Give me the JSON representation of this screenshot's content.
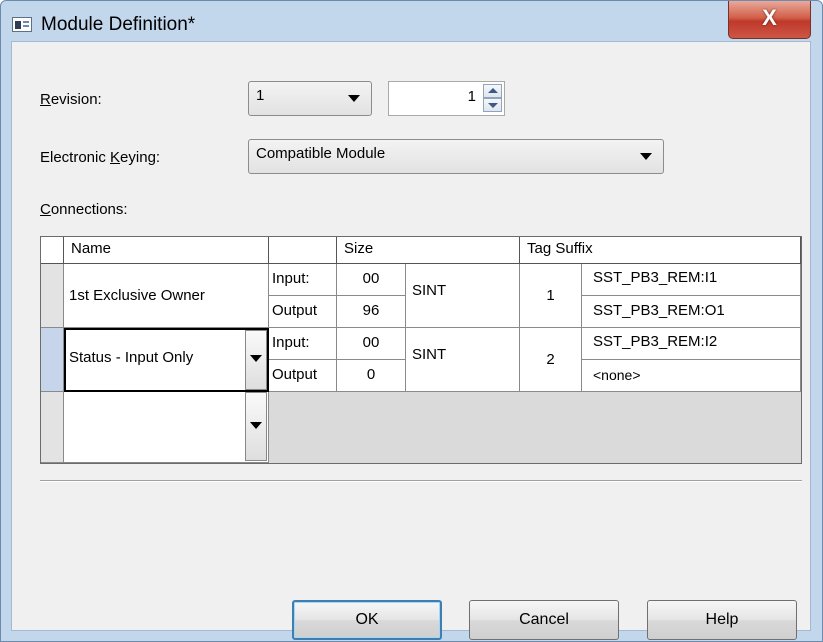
{
  "window": {
    "title": "Module Definition*",
    "close_glyph": "X"
  },
  "revision": {
    "label_u": "R",
    "label_rest": "evision:",
    "major": "1",
    "minor": "1"
  },
  "keying": {
    "label_pre": "Electronic ",
    "label_u": "K",
    "label_rest": "eying:",
    "value": "Compatible Module"
  },
  "connections": {
    "label_u": "C",
    "label_rest": "onnections:",
    "headers": {
      "name": "Name",
      "size": "Size",
      "tag_suffix": "Tag Suffix"
    },
    "rows": [
      {
        "name": "1st Exclusive Owner",
        "input_label": "Input:",
        "input_size": "00",
        "output_label": "Output",
        "output_size": "96",
        "type": "SINT",
        "num": "1",
        "tag_in": "SST_PB3_REM:I1",
        "tag_out": "SST_PB3_REM:O1"
      },
      {
        "name": "Status - Input Only",
        "input_label": "Input:",
        "input_size": "00",
        "output_label": "Output",
        "output_size": "0",
        "type": "SINT",
        "num": "2",
        "tag_in": "SST_PB3_REM:I2",
        "tag_out": "<none>"
      }
    ]
  },
  "buttons": {
    "ok": "OK",
    "cancel": "Cancel",
    "help": "Help"
  },
  "icons": {
    "app": "module-definition-icon",
    "close": "close-icon",
    "dropdown": "chevron-down-icon",
    "spin_up": "spin-up-icon",
    "spin_down": "spin-down-icon"
  }
}
